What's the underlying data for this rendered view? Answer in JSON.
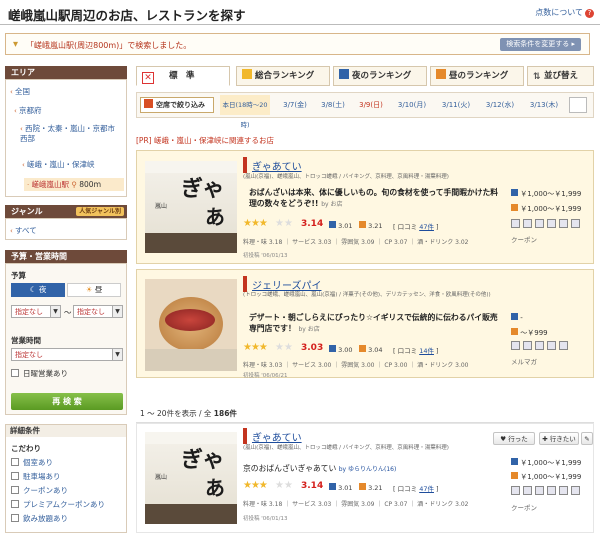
{
  "header": {
    "title": "嵯峨嵐山駅周辺のお店、レストランを探す",
    "help": "点数について",
    "help_icon": "?"
  },
  "search": {
    "message": "「嵯峨嵐山駅(周辺800m)」で検索しました。",
    "change_button": "検索条件を変更する ▸"
  },
  "sidebar": {
    "area_label": "エリア",
    "area_items": [
      "全国",
      "京都府",
      "西院・太秦・嵐山・京都市西部",
      "嵯峨・嵐山・保津峡",
      "嵯峨嵐山駅"
    ],
    "area_dist": "800ｍ",
    "genre_label": "ジャンル",
    "genre_badge": "人気ジャンル別",
    "genre_all": "すべて",
    "budget_label": "予算・営業時間",
    "budget_sub": "予算",
    "night": "夜",
    "lunch": "昼",
    "unset": "指定なし",
    "tilde": "〜",
    "hours_label": "営業時間",
    "sunday": "日曜営業あり",
    "search_button": "再 検 索",
    "detail_label": "詳細条件",
    "kodawari": "こだわり",
    "checks": [
      "個室あり",
      "駐車場あり",
      "クーポンあり",
      "プレミアムクーポンあり",
      "飲み放題あり"
    ]
  },
  "tabs": [
    "標　準",
    "総合ランキング",
    "夜のランキング",
    "昼のランキング",
    "並び替え"
  ],
  "dates": {
    "filter": "空席で絞り込み",
    "today": "本日(18時〜20時)",
    "days": [
      "3/7(金)",
      "3/8(土)",
      "3/9(日)",
      "3/10(月)",
      "3/11(火)",
      "3/12(水)",
      "3/13(木)"
    ]
  },
  "pr_title": "[PR] 嵯峨・嵐山・保津峡に関連するお店",
  "cards": [
    {
      "name": "ぎゃあてい",
      "genre": "(嵐山(京福)、嵯峨嵐山、トロッコ嵯峨 / バイキング、京料理、京風料理・湯葉料理)",
      "catch": "おばんざいは本来、体に優しいもの。旬の食材を使って手間暇かけた料理の数々をどうぞ!!",
      "by": "by お店",
      "stars": "★★★",
      "score": "3.14",
      "night": "3.01",
      "day": "3.21",
      "review_label": "口コミ",
      "reviews": "47件",
      "detail": [
        "料理・味 3.18",
        "サービス 3.03",
        "雰囲気 3.09",
        "CP 3.07",
        "酒・ドリンク 3.02"
      ],
      "posted": "初投稿 '06/01/13",
      "price_night": "￥1,000～￥1,999",
      "price_day": "￥1,000～￥1,999",
      "tag": "クーポン"
    },
    {
      "name": "ジェリーズパイ",
      "genre": "(トロッコ嵯峨、嵯峨嵐山、嵐山(京福) / 洋菓子(その他)、デリカテッセン、洋食・欧風料理(その他))",
      "catch": "デザート・朝ごしらえにぴったり☆イギリスで伝統的に伝わるパイ販売専門店です！",
      "by": "by お店",
      "stars": "★★★",
      "score": "3.03",
      "night": "3.00",
      "day": "3.04",
      "review_label": "口コミ",
      "reviews": "14件",
      "detail": [
        "料理・味 3.03",
        "サービス 3.00",
        "雰囲気 3.00",
        "CP 3.00",
        "酒・ドリンク 3.00"
      ],
      "posted": "初投稿 '06/06/21",
      "price_night": "-",
      "price_day": "～￥999",
      "tag": "メルマガ"
    },
    {
      "name": "ぎゃあてい",
      "genre": "(嵐山(京福)、嵯峨嵐山、トロッコ嵯峨 / バイキング、京料理、京風料理・湯葉料理)",
      "catch": "京のおばんざいぎゃあてい",
      "by": "by ゆらりんりん(16)",
      "stars": "★★★",
      "score": "3.14",
      "night": "3.01",
      "day": "3.21",
      "review_label": "口コミ",
      "reviews": "47件",
      "detail": [
        "料理・味 3.18",
        "サービス 3.03",
        "雰囲気 3.09",
        "CP 3.07",
        "酒・ドリンク 3.02"
      ],
      "posted": "初投稿 '06/01/13",
      "price_night": "￥1,000～￥1,999",
      "price_day": "￥1,000～￥1,999",
      "tag": "クーポン",
      "went": "行った",
      "want": "行きたい"
    }
  ],
  "results": {
    "range": "1 ～ 20件を表示",
    "sep": " / 全 ",
    "total": "186件"
  },
  "icons": {
    "tab_standard": "x-icon",
    "tab_total": "crown-icon",
    "tab_night": "moon-icon",
    "tab_lunch": "sun-icon",
    "tab_sort": "sort-icon",
    "calendar": "calendar-icon"
  },
  "colors": {
    "accent": "#d4201d",
    "link": "#35609c",
    "sidebar_header": "#6e4a3a",
    "button_green": "#6aa72a"
  }
}
